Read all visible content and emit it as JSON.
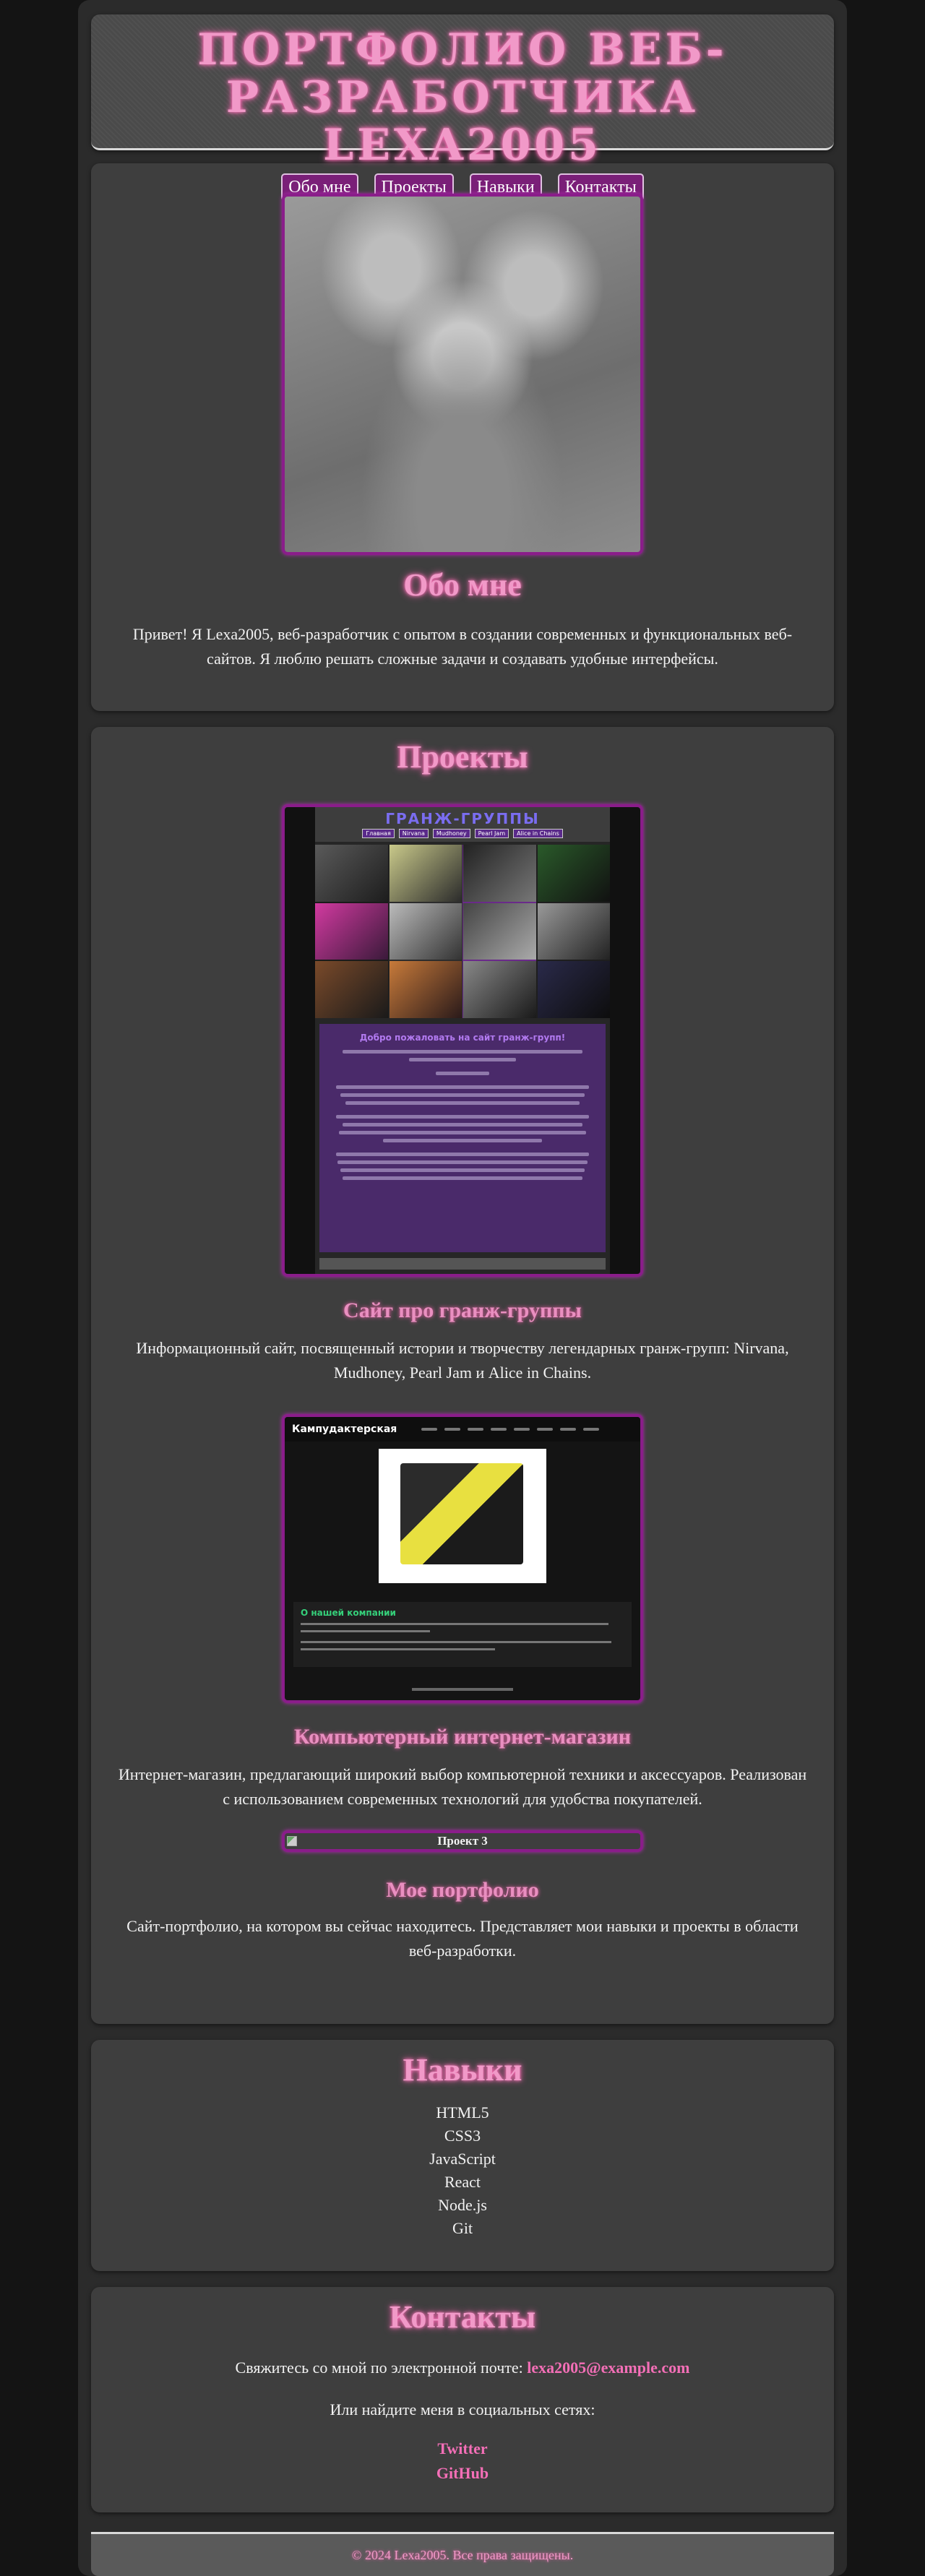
{
  "header": {
    "title": "ПОРТФОЛИО ВЕБ-РАЗРАБОТЧИКА LEXA2005",
    "nav": [
      "Обо мне",
      "Проекты",
      "Навыки",
      "Контакты"
    ]
  },
  "about": {
    "title": "Обо мне",
    "text": "Привет! Я Lexa2005, веб-разработчик с опытом в создании современных и функциональных веб-сайтов. Я люблю решать сложные задачи и создавать удобные интерфейсы."
  },
  "projects": {
    "title": "Проекты",
    "items": [
      {
        "title": "Сайт про гранж-группы",
        "description": "Информационный сайт, посвященный истории и творчеству легендарных гранж-групп: Nirvana, Mudhoney, Pearl Jam и Alice in Chains.",
        "thumb": {
          "site_title": "ГРАНЖ-ГРУППЫ",
          "nav": [
            "Главная",
            "Nirvana",
            "Mudhoney",
            "Pearl Jam",
            "Alice in Chains"
          ],
          "heading": "Добро пожаловать на сайт гранж-групп!"
        }
      },
      {
        "title": "Компьютерный интернет-магазин",
        "description": "Интернет-магазин, предлагающий широкий выбор компьютерной техники и аксессуаров. Реализован с использованием современных технологий для удобства покупателей.",
        "thumb": {
          "logo": "Кампудактерская",
          "about_heading": "О нашей компании"
        }
      },
      {
        "title": "Мое портфолио",
        "description": "Сайт-портфолио, на котором вы сейчас находитесь. Представляет мои навыки и проекты в области веб-разработки.",
        "image_alt": "Проект 3"
      }
    ]
  },
  "skills": {
    "title": "Навыки",
    "items": [
      "HTML5",
      "CSS3",
      "JavaScript",
      "React",
      "Node.js",
      "Git"
    ]
  },
  "contacts": {
    "title": "Контакты",
    "email_prefix": "Свяжитесь со мной по электронной почте: ",
    "email": "lexa2005@example.com",
    "social_text": "Или найдите меня в социальных сетях:",
    "links": [
      "Twitter",
      "GitHub"
    ]
  },
  "footer": {
    "text": "© 2024 Lexa2005. Все права защищены."
  },
  "colors": {
    "accent_pink": "#f199c8",
    "link_pink": "#f46fb7",
    "frame_purple": "#8a1d8a",
    "nav_purple": "#7a1f78",
    "card_bg": "#3e3e3e",
    "page_bg": "#2b2b2b"
  }
}
